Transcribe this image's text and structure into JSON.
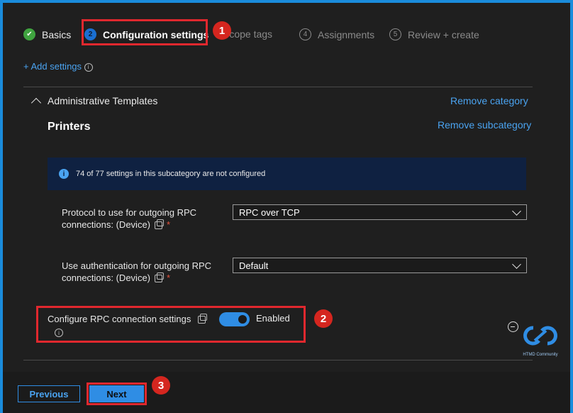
{
  "steps": [
    {
      "num": "✔",
      "label": "Basics",
      "state": "done"
    },
    {
      "num": "2",
      "label": "Configuration settings",
      "state": "current"
    },
    {
      "num": "3",
      "label": "Scope tags",
      "state": "pending"
    },
    {
      "num": "4",
      "label": "Assignments",
      "state": "pending"
    },
    {
      "num": "5",
      "label": "Review + create",
      "state": "pending"
    }
  ],
  "callouts": [
    "1",
    "2",
    "3"
  ],
  "add_settings": "+ Add settings",
  "category": {
    "name": "Administrative Templates",
    "remove_category": "Remove category",
    "subcategory": "Printers",
    "remove_subcategory": "Remove subcategory",
    "info_banner": "74 of 77 settings in this subcategory are not configured"
  },
  "settings": [
    {
      "label_line1": "Protocol to use for outgoing RPC",
      "label_line2": "connections: (Device)",
      "required": "*",
      "value": "RPC over TCP"
    },
    {
      "label_line1": "Use authentication for outgoing RPC",
      "label_line2": "connections: (Device)",
      "required": "*",
      "value": "Default"
    }
  ],
  "toggle_setting": {
    "label": "Configure RPC connection settings",
    "state": "Enabled",
    "on": true
  },
  "watermark": {
    "text": "HTMD Community"
  },
  "footer": {
    "previous": "Previous",
    "next": "Next"
  },
  "colors": {
    "accent": "#2f8de4",
    "callout": "#e0282e",
    "link": "#4aa3f0",
    "banner": "#0f2141"
  }
}
